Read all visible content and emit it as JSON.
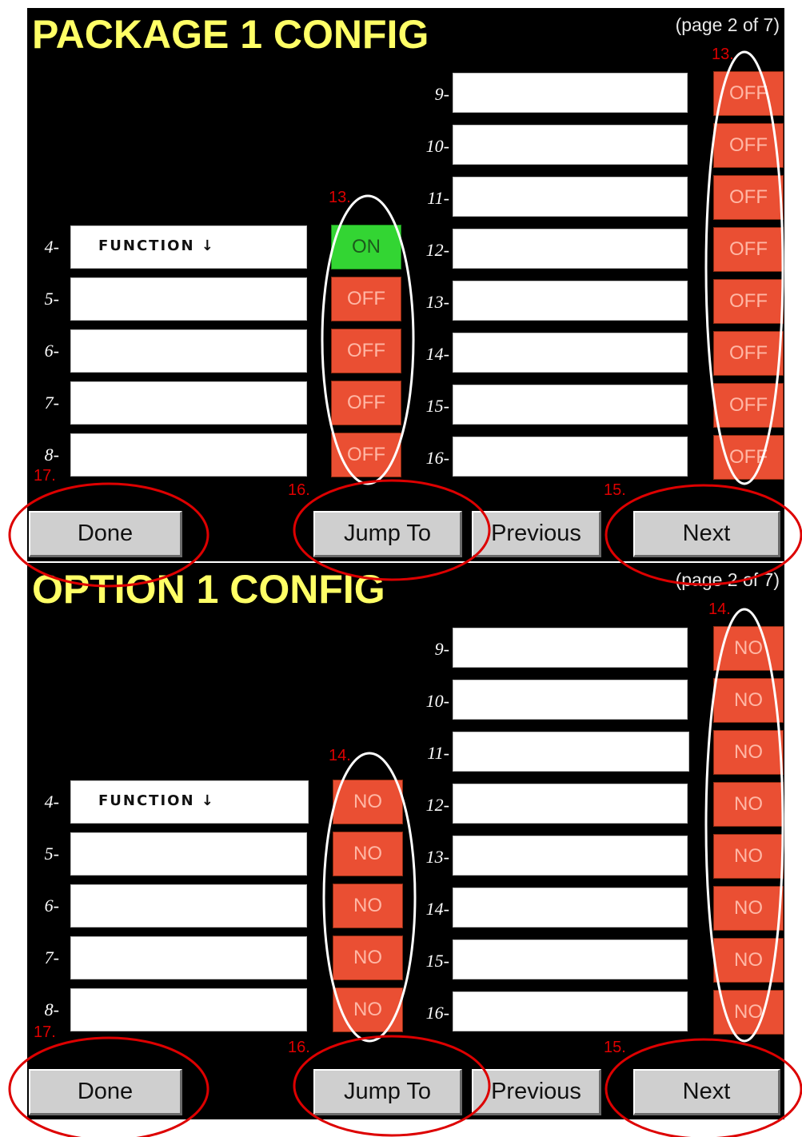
{
  "panels": [
    {
      "title": "PACKAGE 1 CONFIG",
      "page_info": "(page 2 of 7)",
      "left_rows": [
        {
          "number": "4",
          "field_text": "FUNCTION ↓",
          "state": "ON"
        },
        {
          "number": "5",
          "field_text": "",
          "state": "OFF"
        },
        {
          "number": "6",
          "field_text": "",
          "state": "OFF"
        },
        {
          "number": "7",
          "field_text": "",
          "state": "OFF"
        },
        {
          "number": "8",
          "field_text": "",
          "state": "OFF"
        }
      ],
      "right_rows": [
        {
          "number": "9",
          "field_text": "",
          "state": "OFF"
        },
        {
          "number": "10",
          "field_text": "",
          "state": "OFF"
        },
        {
          "number": "11",
          "field_text": "",
          "state": "OFF"
        },
        {
          "number": "12",
          "field_text": "",
          "state": "OFF"
        },
        {
          "number": "13",
          "field_text": "",
          "state": "OFF"
        },
        {
          "number": "14",
          "field_text": "",
          "state": "OFF"
        },
        {
          "number": "15",
          "field_text": "",
          "state": "OFF"
        },
        {
          "number": "16",
          "field_text": "",
          "state": "OFF"
        }
      ],
      "buttons": {
        "done": "Done",
        "jump_to": "Jump To",
        "previous": "Previous",
        "next": "Next"
      },
      "annotations": {
        "left_toggles": "13.",
        "right_toggles": "13.",
        "done": "17.",
        "jump_to": "16.",
        "next": "15."
      }
    },
    {
      "title": "OPTION 1 CONFIG",
      "page_info": "(page 2 of 7)",
      "left_rows": [
        {
          "number": "4",
          "field_text": "FUNCTION ↓",
          "state": "NO"
        },
        {
          "number": "5",
          "field_text": "",
          "state": "NO"
        },
        {
          "number": "6",
          "field_text": "",
          "state": "NO"
        },
        {
          "number": "7",
          "field_text": "",
          "state": "NO"
        },
        {
          "number": "8",
          "field_text": "",
          "state": "NO"
        }
      ],
      "right_rows": [
        {
          "number": "9",
          "field_text": "",
          "state": "NO"
        },
        {
          "number": "10",
          "field_text": "",
          "state": "NO"
        },
        {
          "number": "11",
          "field_text": "",
          "state": "NO"
        },
        {
          "number": "12",
          "field_text": "",
          "state": "NO"
        },
        {
          "number": "13",
          "field_text": "",
          "state": "NO"
        },
        {
          "number": "14",
          "field_text": "",
          "state": "NO"
        },
        {
          "number": "15",
          "field_text": "",
          "state": "NO"
        },
        {
          "number": "16",
          "field_text": "",
          "state": "NO"
        }
      ],
      "buttons": {
        "done": "Done",
        "jump_to": "Jump To",
        "previous": "Previous",
        "next": "Next"
      },
      "annotations": {
        "left_toggles": "14.",
        "right_toggles": "14.",
        "done": "17.",
        "jump_to": "16.",
        "next": "15."
      }
    }
  ],
  "colors": {
    "background": "#000000",
    "title": "#ffff66",
    "toggle_off": "#ea4f33",
    "toggle_on": "#33d533",
    "annotation": "#dd0000",
    "button_face": "#cfcfcf"
  }
}
